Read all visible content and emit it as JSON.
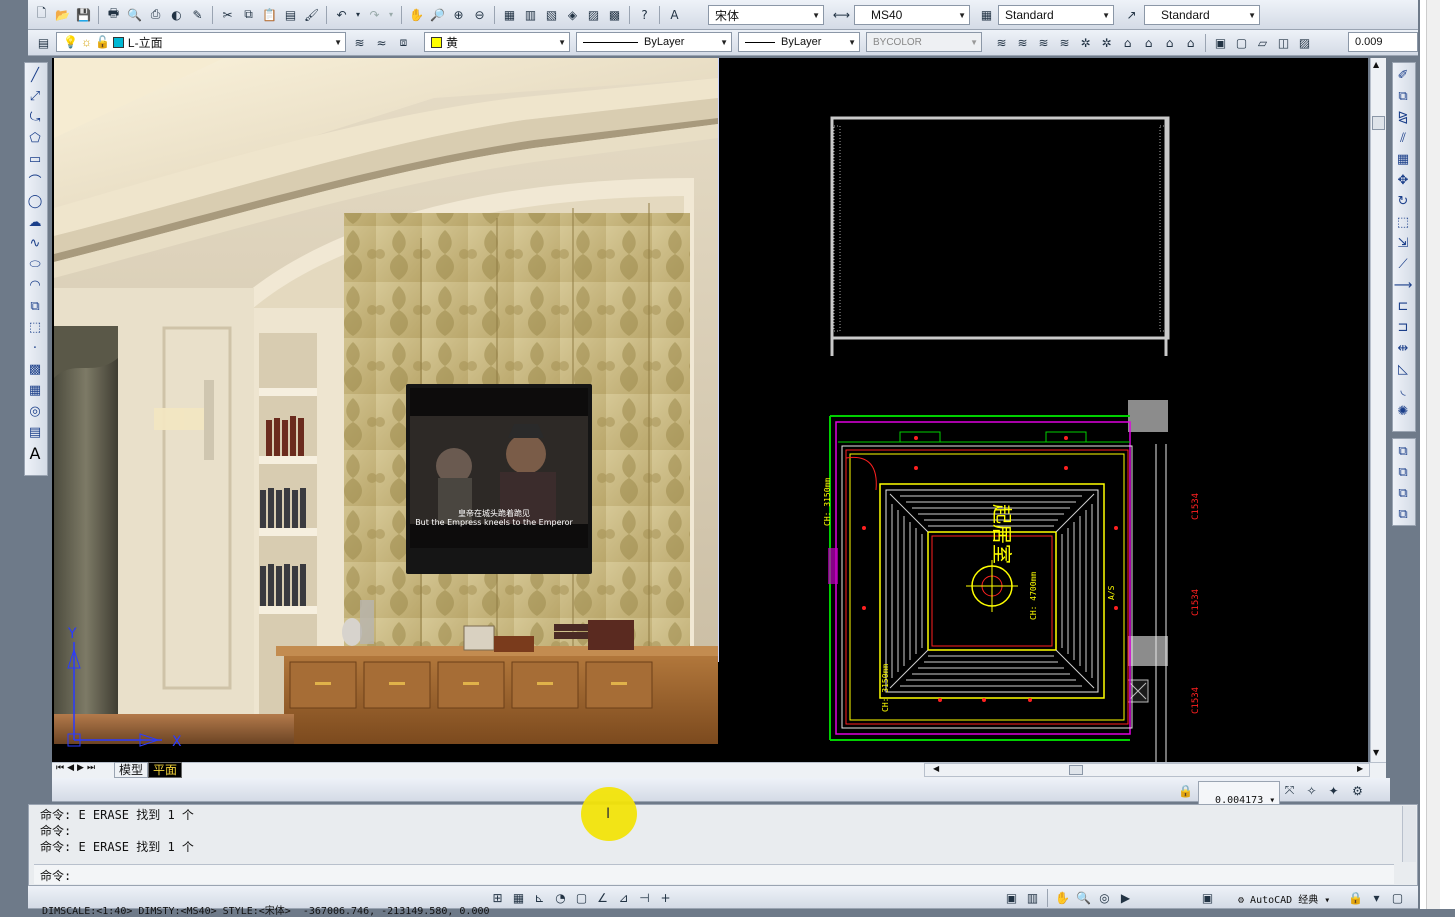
{
  "toolbar_std": {
    "text_style": "宋体",
    "dim_style": "MS40",
    "table_style": "Standard",
    "multileader_style": "Standard"
  },
  "toolbar_layers": {
    "layer": "L-立面",
    "color": "黄",
    "linetype": "ByLayer",
    "lineweight": "ByLayer",
    "plotstyle": "BYCOLOR",
    "viewport_scale": "0.009"
  },
  "colors": {
    "layer_color": "#ffff00",
    "cad_bg": "#000000",
    "marker": "#f2e40a"
  },
  "tv": {
    "subtitle_cn": "皇帝在城头跪着跪见",
    "subtitle_en": "But the Empress kneels to the Emperor"
  },
  "ucs": {
    "y": "Y",
    "x": "X"
  },
  "tabs": [
    {
      "label": "模型",
      "active": false
    },
    {
      "label": "平面",
      "active": true
    }
  ],
  "layout_status": {
    "scale": "0.004173"
  },
  "plan_labels": {
    "room_name": "起居室",
    "ceiling_center": "CH: 4700mm",
    "ceiling_left_top": "CH: 3150mm",
    "ceiling_left_bottom": "CH: 3150mm",
    "right_1": "C1534",
    "right_2": "C1534",
    "right_3": "C1534",
    "as": "A/S"
  },
  "command": {
    "lines": [
      "命令: E ERASE 找到 1 个",
      "命令:",
      "命令: E ERASE 找到 1 个"
    ],
    "prompt": "命令:"
  },
  "status_bar": {
    "info": "DIMSCALE:<1:40> DIMSTY:<MS40> STYLE:<宋体>",
    "coords": "-367006.746, -213149.580, 0.000",
    "workspace": "AutoCAD 经典"
  }
}
